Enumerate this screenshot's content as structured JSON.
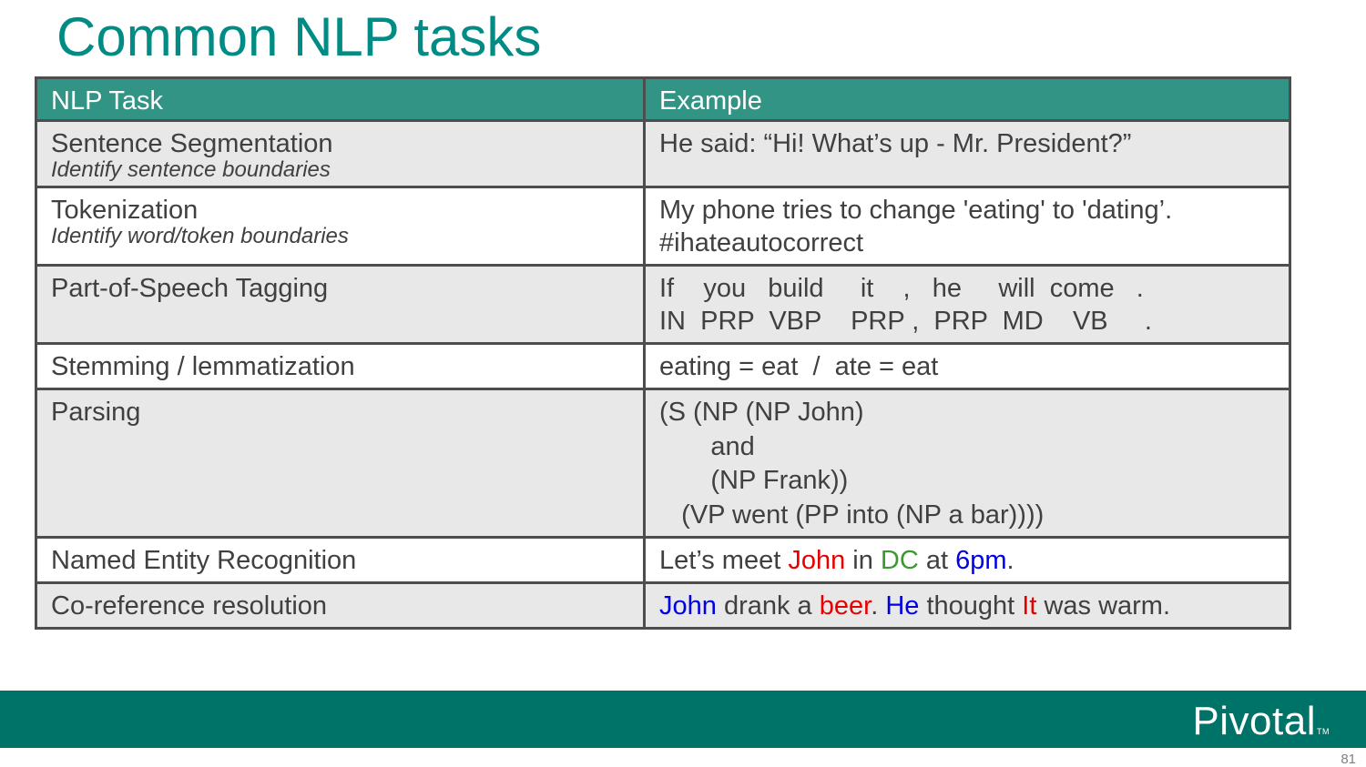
{
  "title": "Common NLP tasks",
  "table": {
    "headers": [
      "NLP Task",
      "Example"
    ],
    "rows": [
      {
        "task": "Sentence Segmentation",
        "subtitle": "Identify sentence boundaries",
        "example": "He said: “Hi! What’s up - Mr. President?”"
      },
      {
        "task": "Tokenization",
        "subtitle": "Identify word/token boundaries",
        "example_lines": [
          "My phone tries to change 'eating' to 'dating’.",
          "#ihateautocorrect"
        ]
      },
      {
        "task": "Part-of-Speech Tagging",
        "example_lines": [
          "If    you   build     it    ,   he     will  come   .",
          "IN  PRP  VBP    PRP ,  PRP  MD    VB     ."
        ]
      },
      {
        "task": "Stemming / lemmatization",
        "example": "eating = eat  /  ate = eat"
      },
      {
        "task": "Parsing",
        "example_lines": [
          "(S (NP (NP John)",
          "       and",
          "       (NP Frank))",
          "   (VP went (PP into (NP a bar))))"
        ]
      },
      {
        "task": "Named Entity Recognition",
        "example_parts": [
          "Let’s meet ",
          "John",
          " in ",
          "DC",
          " at ",
          "6pm",
          "."
        ]
      },
      {
        "task": "Co-reference resolution",
        "example_parts": [
          "John",
          " drank a ",
          "beer",
          ". ",
          "He",
          " thought ",
          "It",
          " was warm."
        ]
      }
    ]
  },
  "colors": {
    "title": "#008c84",
    "header_bg": "#329485",
    "footer_bg": "#007369",
    "entity_red": "#e60000",
    "entity_green": "#3a9a2e",
    "entity_blue": "#0000e6"
  },
  "footer": {
    "logo": "Pivotal",
    "trademark": "TM"
  },
  "page_number": "81"
}
